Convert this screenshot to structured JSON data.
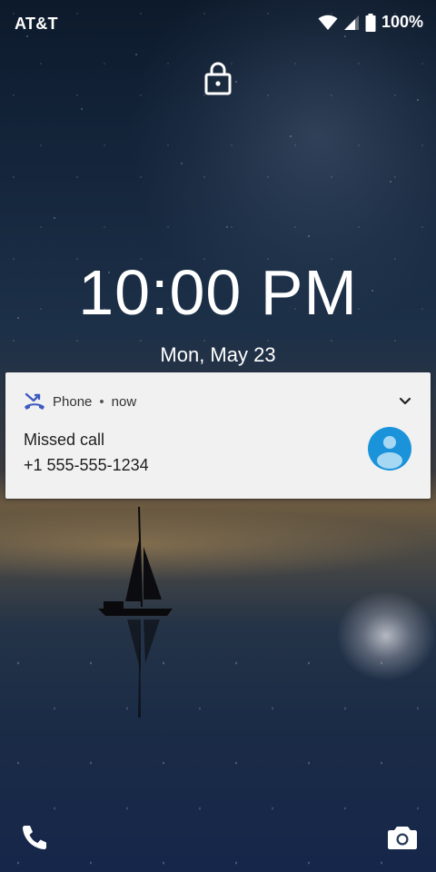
{
  "status_bar": {
    "carrier": "AT&T",
    "battery_percent": "100%",
    "icons": [
      "wifi-icon",
      "cellular-signal-icon",
      "battery-icon"
    ]
  },
  "lockscreen": {
    "lock_icon": "lock-icon",
    "time": "10:00 PM",
    "date": "Mon, May 23"
  },
  "notification": {
    "app_name": "Phone",
    "separator": "•",
    "time": "now",
    "title": "Missed call",
    "text": "+1  555-555-1234",
    "icons": [
      "missed-call-icon",
      "chevron-down-icon",
      "contact-avatar-icon"
    ]
  },
  "shortcuts": {
    "left": "phone-icon",
    "right": "camera-icon"
  },
  "colors": {
    "notification_bg": "#f1f1f1",
    "avatar_bg": "#1a93db",
    "phone_app_accent": "#3d5bbf"
  }
}
